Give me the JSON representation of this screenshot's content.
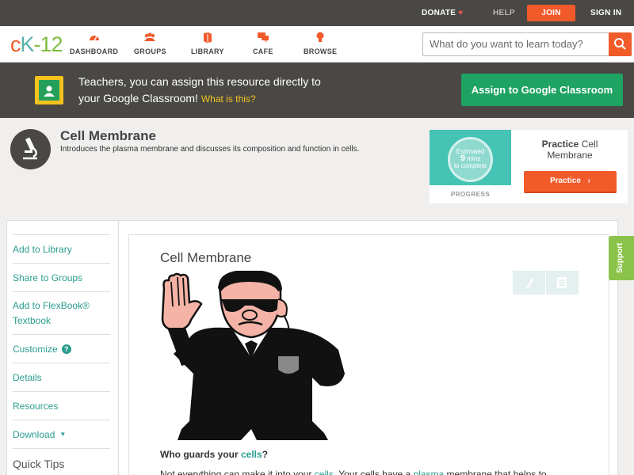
{
  "topbar": {
    "donate": "DONATE",
    "help": "HELP",
    "join": "JOIN",
    "signin": "SIGN IN"
  },
  "logo": {
    "part1": "c",
    "part2": "K",
    "part3": "-12"
  },
  "nav": {
    "items": [
      {
        "label": "DASHBOARD",
        "icon": "dashboard-icon"
      },
      {
        "label": "GROUPS",
        "icon": "groups-icon"
      },
      {
        "label": "LIBRARY",
        "icon": "library-icon"
      },
      {
        "label": "CAFE",
        "icon": "cafe-icon"
      },
      {
        "label": "BROWSE",
        "icon": "browse-icon"
      }
    ],
    "search_placeholder": "What do you want to learn today?"
  },
  "banner": {
    "line1": "Teachers, you can assign this resource directly to",
    "line2": "your Google Classroom!",
    "what": "What is this?",
    "assign": "Assign to Google Classroom"
  },
  "header": {
    "title": "Cell Membrane",
    "description": "Introduces the plasma membrane and discusses its composition and function in cells."
  },
  "practice": {
    "est1": "Estimated",
    "est_num": "9",
    "est_unit": "mins",
    "est2": "to complete",
    "progress": "PROGRESS",
    "title_bold": "Practice",
    "title_rest": "Cell Membrane",
    "button": "Practice"
  },
  "sidebar": {
    "items": [
      "Add to Library",
      "Share to Groups",
      "Add to FlexBook®",
      "Textbook",
      "Customize",
      "Details",
      "Resources",
      "Download"
    ],
    "quick_tips": "Quick Tips"
  },
  "article": {
    "title": "Cell Membrane",
    "question_pre": "Who guards your ",
    "question_link": "cells",
    "question_post": "?",
    "para_pre": "Not everything can make it into your ",
    "para_link1": "cells",
    "para_mid": ". Your cells have a ",
    "para_link2": "plasma",
    "para_post": " membrane that helps to"
  },
  "support": "Support",
  "colors": {
    "accent": "#f15a29",
    "teal": "#2a9d8f",
    "green": "#1ea362",
    "dark": "#4a4845"
  }
}
